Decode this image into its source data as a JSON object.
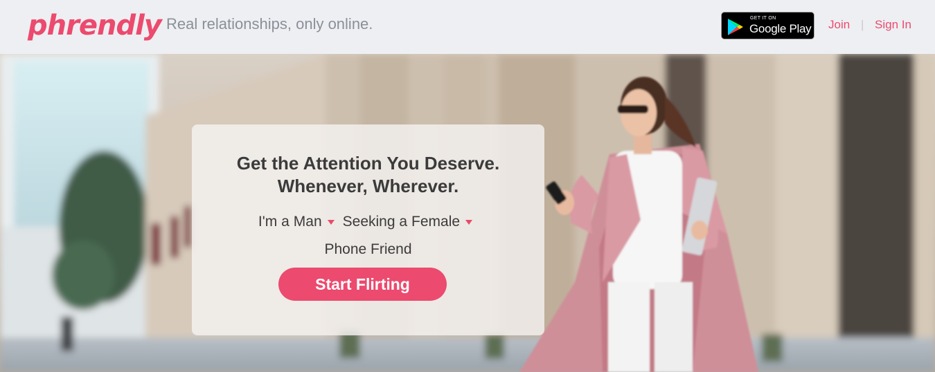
{
  "colors": {
    "brand": "#ec4a6e",
    "tagline": "#8a9099",
    "header_bg": "#eeeff2",
    "cta_bg": "#ec4a6e"
  },
  "header": {
    "logo_text": "phrendly",
    "tagline": "Real relationships, only online.",
    "google_play": {
      "small_text": "GET IT ON",
      "big_text": "Google Play"
    },
    "nav": {
      "join": "Join",
      "separator": "|",
      "sign_in": "Sign In"
    }
  },
  "hero": {
    "headline_line1": "Get the Attention You Deserve.",
    "headline_line2": "Whenever, Wherever.",
    "form": {
      "im_a_label": "I'm a",
      "gender_value": "Man",
      "seeking_label": "Seeking a",
      "seeking_value": "Female",
      "relationship_type": "Phone Friend"
    },
    "cta_label": "Start Flirting"
  },
  "icons": {
    "google_play": "google-play-logo-icon",
    "dropdown": "caret-down-icon"
  }
}
